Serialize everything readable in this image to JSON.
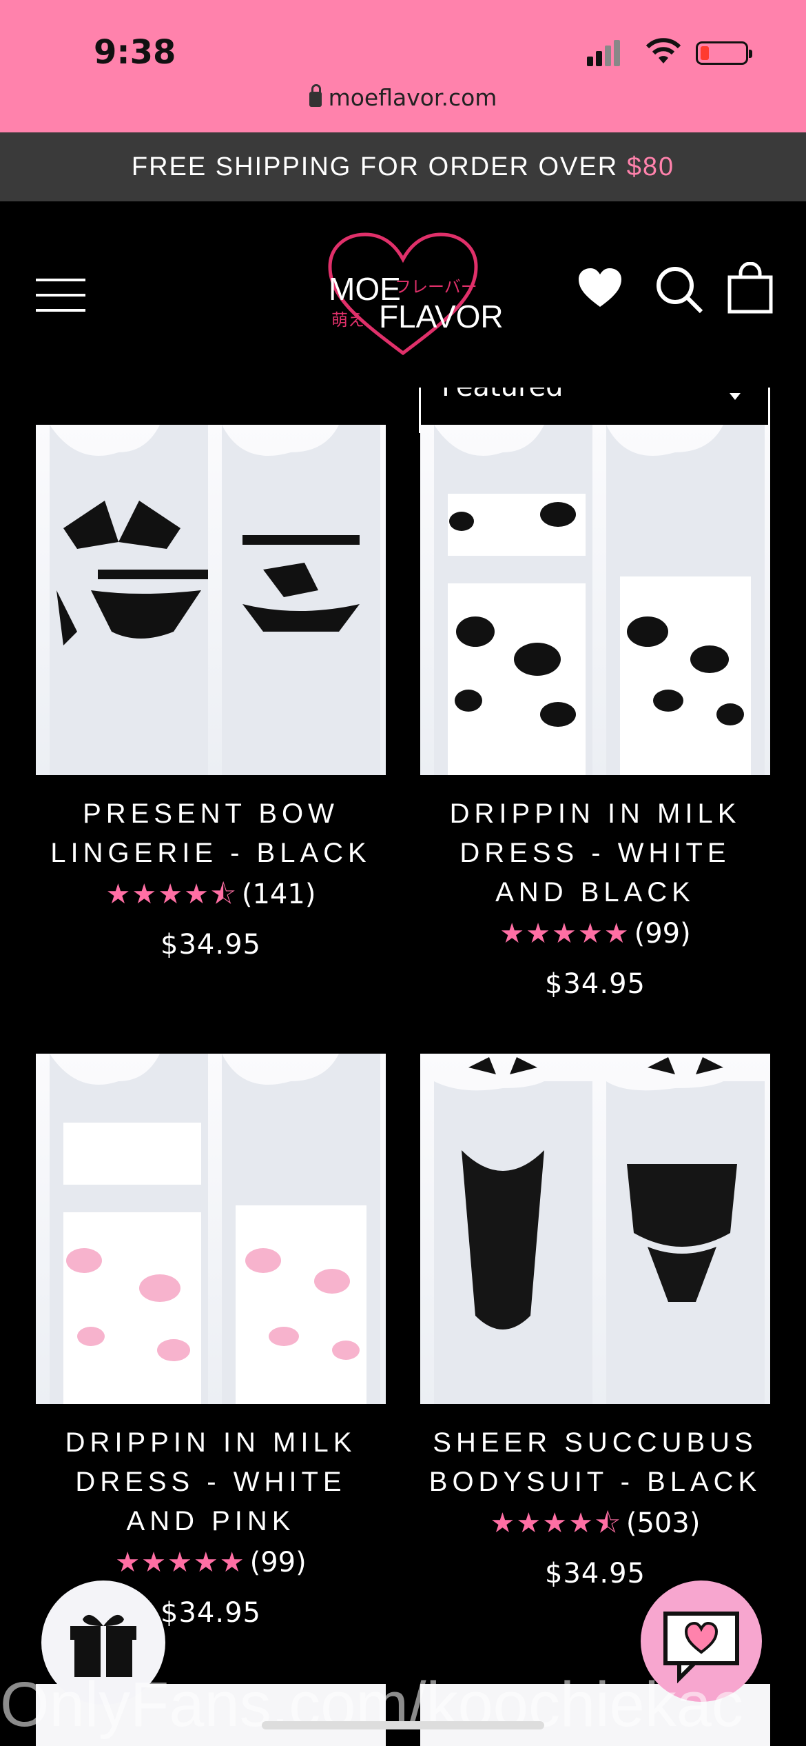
{
  "status_bar": {
    "time": "9:38",
    "url": "moeflavor.com",
    "battery_level": 0.15
  },
  "announcement": {
    "text": "FREE SHIPPING FOR ORDER OVER ",
    "amount": "$80"
  },
  "header": {
    "logo_line1": "MOE",
    "logo_line2": "FLAVOR",
    "logo_jp1": "フレーバー",
    "logo_jp2": "萌え"
  },
  "sort": {
    "selected": "Featured"
  },
  "products": [
    {
      "title": "PRESENT BOW LINGERIE - BLACK",
      "stars": "★★★★⯪",
      "rating_value": 4.5,
      "reviews": "(141)",
      "price": "$34.95",
      "image": "black-bow-lingerie"
    },
    {
      "title": "DRIPPIN IN MILK DRESS - WHITE AND BLACK",
      "stars": "★★★★★",
      "rating_value": 5,
      "reviews": "(99)",
      "price": "$34.95",
      "image": "cow-print-dress-black"
    },
    {
      "title": "DRIPPIN IN MILK DRESS - WHITE AND PINK",
      "stars": "★★★★★",
      "rating_value": 5,
      "reviews": "(99)",
      "price": "$34.95",
      "image": "cow-print-dress-pink"
    },
    {
      "title": "SHEER SUCCUBUS BODYSUIT - BLACK",
      "stars": "★★★★⯪",
      "rating_value": 4.5,
      "reviews": "(503)",
      "price": "$34.95",
      "image": "black-succubus-bodysuit"
    }
  ],
  "overlay": {
    "watermark": "OnlyFans.com/koochiekac"
  },
  "colors": {
    "accent_pink": "#ff82ac",
    "star_pink": "#ff6fa4",
    "announcement_bg": "#3a3a3a"
  },
  "icons": [
    "lock-icon",
    "signal-icon",
    "wifi-icon",
    "battery-icon",
    "menu-icon",
    "heart-icon",
    "search-icon",
    "bag-icon",
    "gift-icon",
    "chat-heart-icon"
  ]
}
